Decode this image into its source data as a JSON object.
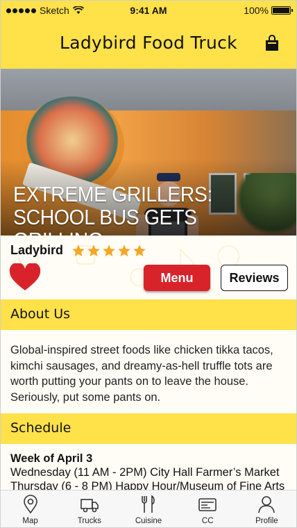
{
  "status_bar": {
    "carrier": "Sketch",
    "time": "9:41 AM",
    "battery": "100%"
  },
  "header": {
    "title": "Ladybird Food Truck",
    "cart_icon": "shopping-bag-icon"
  },
  "hero": {
    "headline_line1": "EXTREME GRILLERS:",
    "headline_line2": "SCHOOL BUS GETS GRILLING"
  },
  "truck": {
    "name": "Ladybird",
    "rating": 5,
    "rating_max": 5,
    "favorite": true
  },
  "actions": {
    "menu_label": "Menu",
    "reviews_label": "Reviews"
  },
  "about": {
    "heading": "About Us",
    "text": "Global-inspired street foods like chicken tikka tacos, kimchi sausages, and dreamy-as-hell truffle tots are worth putting your pants on to leave the house. Seriously, put some pants on."
  },
  "schedule": {
    "heading": "Schedule",
    "week": "Week of April 3",
    "entries": [
      "Wednesday (11 AM - 2PM) City Hall Farmer’s Market",
      "Thursday (6 - 8 PM) Happy Hour/Museum of Fine Arts"
    ]
  },
  "tabs": [
    {
      "label": "Map",
      "icon": "map-pin-icon"
    },
    {
      "label": "Trucks",
      "icon": "truck-icon"
    },
    {
      "label": "Cuisine",
      "icon": "fork-knife-icon"
    },
    {
      "label": "CC",
      "icon": "card-icon"
    },
    {
      "label": "Profile",
      "icon": "person-icon"
    }
  ],
  "colors": {
    "brand_yellow": "#ffe14a",
    "menu_red": "#d9232a",
    "star_orange": "#f6a623",
    "heart_red": "#d9232a"
  }
}
